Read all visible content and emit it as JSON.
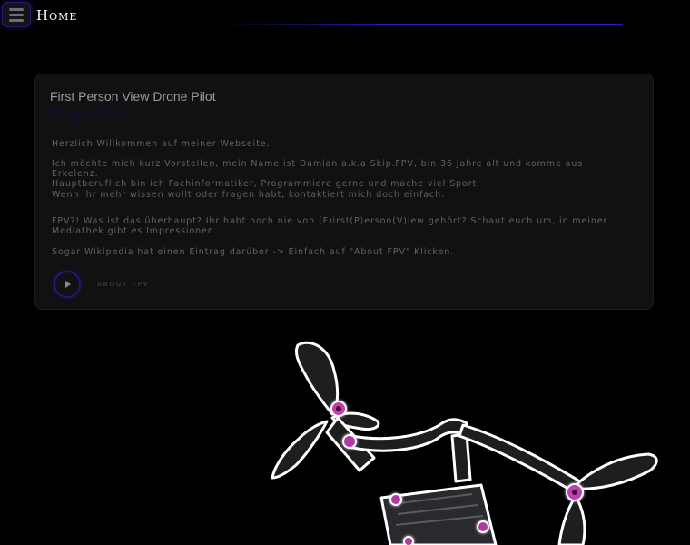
{
  "nav": {
    "menu_icon": "hamburger-icon",
    "title": "Home",
    "accent_color": "#3218c8"
  },
  "card": {
    "subtitle": "First Person View Drone Pilot",
    "title": "Skip.FPV",
    "welcome": "Herzlich Willkommen auf meiner Webseite.",
    "intro": "Ich möchte mich kurz Vorstellen, mein Name ist Damian a.k.a Skip.FPV, bin 36 Jahre alt und komme aus Erkelenz.\nHauptberuflich bin ich Fachinformatiker, Programmiere gerne und mache viel Sport.",
    "contact": "Wenn ihr mehr wissen wollt oder fragen habt, kontaktiert mich doch einfach.",
    "fpv": "FPV?! Was ist das überhaupt? Ihr habt noch nie von (F)irst(P)erson(V)iew gehört? Schaut euch um, in meiner\nMediathek gibt es Impressionen.",
    "wiki": "Sogar Wikipedia hat einen Eintrag darüber -> Einfach auf \"About FPV\" Klicken.",
    "play_icon": "play-icon",
    "about_label": "ABOUT FPV"
  },
  "image": {
    "icon": "fpv-drone-illustration",
    "accent_color": "#c040b0"
  }
}
